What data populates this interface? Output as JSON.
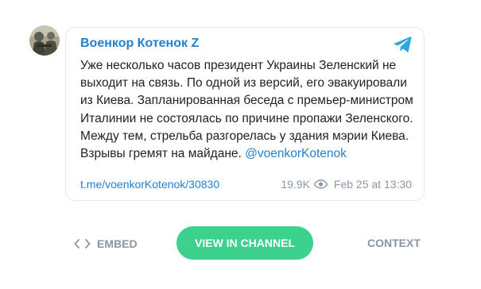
{
  "post": {
    "author": "Военкор Котенок Z",
    "text": "Уже несколько часов президент Украины Зеленский не выходит на связь. По одной из версий, его эвакуировали из Киева. Запланированная беседа с премьер-министром Италинии не состоялась по причине пропажи Зеленского. Между тем, стрельба разгорелась у здания мэрии Киева. Взрывы гремят на майдане. ",
    "mention": "@voenkorKotenok",
    "link": "t.me/voenkorKotenok/30830",
    "views": "19.9K",
    "date": "Feb 25 at 13:30",
    "avatar_icon": "channel-avatar",
    "platform_icon": "telegram-icon"
  },
  "actions": {
    "embed_label": "EMBED",
    "view_label": "VIEW IN CHANNEL",
    "context_label": "CONTEXT"
  },
  "colors": {
    "link": "#2481cc",
    "button": "#3cd18c",
    "muted": "#8a96a3"
  }
}
